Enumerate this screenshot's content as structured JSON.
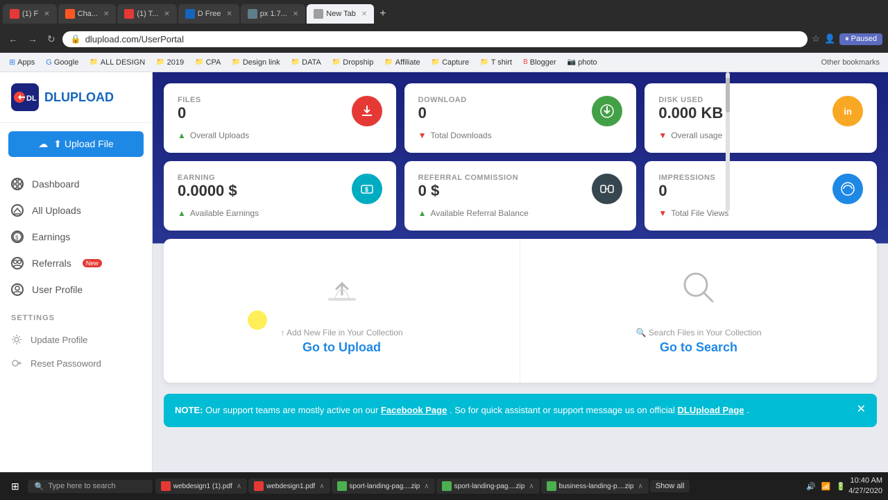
{
  "browser": {
    "url": "dlupload.com/UserPortal",
    "tabs": [
      {
        "label": "(1) F",
        "active": false,
        "favicon_color": "#e53935"
      },
      {
        "label": "Cha...",
        "active": false,
        "favicon_color": "#ff5722"
      },
      {
        "label": "(1) T...",
        "active": false,
        "favicon_color": "#e53935"
      },
      {
        "label": "D Free",
        "active": false,
        "favicon_color": "#1565c0"
      },
      {
        "label": "px 1.7...",
        "active": false,
        "favicon_color": "#607d8b"
      },
      {
        "label": "New Tab",
        "active": true,
        "favicon_color": "#9e9e9e"
      }
    ],
    "bookmarks": [
      {
        "label": "Apps",
        "icon_color": "#4285f4"
      },
      {
        "label": "Google",
        "icon_color": "#4285f4"
      },
      {
        "label": "ALL DESIGN",
        "icon_color": "#2196f3"
      },
      {
        "label": "2019",
        "icon_color": "#f44336"
      },
      {
        "label": "CPA",
        "icon_color": "#9c27b0"
      },
      {
        "label": "Design link",
        "icon_color": "#ff9800"
      },
      {
        "label": "DATA",
        "icon_color": "#607d8b"
      },
      {
        "label": "Dropship",
        "icon_color": "#4caf50"
      },
      {
        "label": "Affiliate",
        "icon_color": "#009688"
      },
      {
        "label": "Capture",
        "icon_color": "#ff5722"
      },
      {
        "label": "T shirt",
        "icon_color": "#795548"
      },
      {
        "label": "Blogger",
        "icon_color": "#f44336"
      },
      {
        "label": "photo",
        "icon_color": "#e91e63"
      },
      {
        "label": "Other bookmarks",
        "is_other": true
      }
    ]
  },
  "sidebar": {
    "logo_letters": "DL",
    "logo_name_part1": "DL",
    "logo_name_part2": "UPLOAD",
    "upload_btn_label": "⬆ Upload File",
    "nav_items": [
      {
        "label": "Dashboard",
        "icon": "dashboard"
      },
      {
        "label": "All Uploads",
        "icon": "uploads"
      },
      {
        "label": "Earnings",
        "icon": "earnings"
      },
      {
        "label": "Referrals",
        "icon": "referrals",
        "badge": "New"
      },
      {
        "label": "User Profile",
        "icon": "profile"
      }
    ],
    "settings_header": "SETTINGS",
    "settings_items": [
      {
        "label": "Update Profile"
      },
      {
        "label": "Reset Passoword"
      }
    ]
  },
  "stats": {
    "cards": [
      {
        "label": "FILES",
        "value": "0",
        "icon": "☁",
        "icon_class": "red",
        "footer_arrow": "up",
        "footer_text": "Overall Uploads"
      },
      {
        "label": "DOWNLOAD",
        "value": "0",
        "icon": "☁",
        "icon_class": "green",
        "footer_arrow": "down",
        "footer_text": "Total Downloads"
      },
      {
        "label": "DISK USED",
        "value": "0.000 KB",
        "icon": "in",
        "icon_class": "amber",
        "footer_arrow": "down",
        "footer_text": "Overall usage"
      },
      {
        "label": "EARNING",
        "value": "0.0000 $",
        "icon": "$",
        "icon_class": "cyan",
        "footer_arrow": "up",
        "footer_text": "Available Earnings"
      },
      {
        "label": "REFERRAL COMMISSION",
        "value": "0 $",
        "icon": "↔",
        "icon_class": "dark",
        "footer_arrow": "up",
        "footer_text": "Available Referral Balance"
      },
      {
        "label": "IMPRESSIONS",
        "value": "0",
        "icon": "☁",
        "icon_class": "blue",
        "footer_arrow": "down",
        "footer_text": "Total File Views"
      }
    ]
  },
  "action_section": {
    "upload_sub": "↑ Add New File in Your Collection",
    "upload_link": "Go to Upload",
    "search_sub": "🔍 Search Files in Your Collection",
    "search_link": "Go to Search"
  },
  "notice": {
    "prefix": "NOTE:",
    "text": " Our support teams are mostly active on our ",
    "link1": "Facebook Page",
    "middle": " . So for quick assistant or support message us on official ",
    "link2": "DLUpload Page",
    "suffix": "."
  },
  "taskbar": {
    "apps": [
      {
        "label": "webdesign1 (1).pdf",
        "icon_color": "#e53935"
      },
      {
        "label": "webdesign1.pdf",
        "icon_color": "#e53935"
      },
      {
        "label": "sport-landing-pag....zip",
        "icon_color": "#4caf50"
      },
      {
        "label": "sport-landing-pag....zip",
        "icon_color": "#4caf50"
      },
      {
        "label": "business-landing-p....zip",
        "icon_color": "#4caf50"
      }
    ],
    "show_all": "Show all",
    "time": "10:40 AM",
    "date": "4/27/2020"
  }
}
